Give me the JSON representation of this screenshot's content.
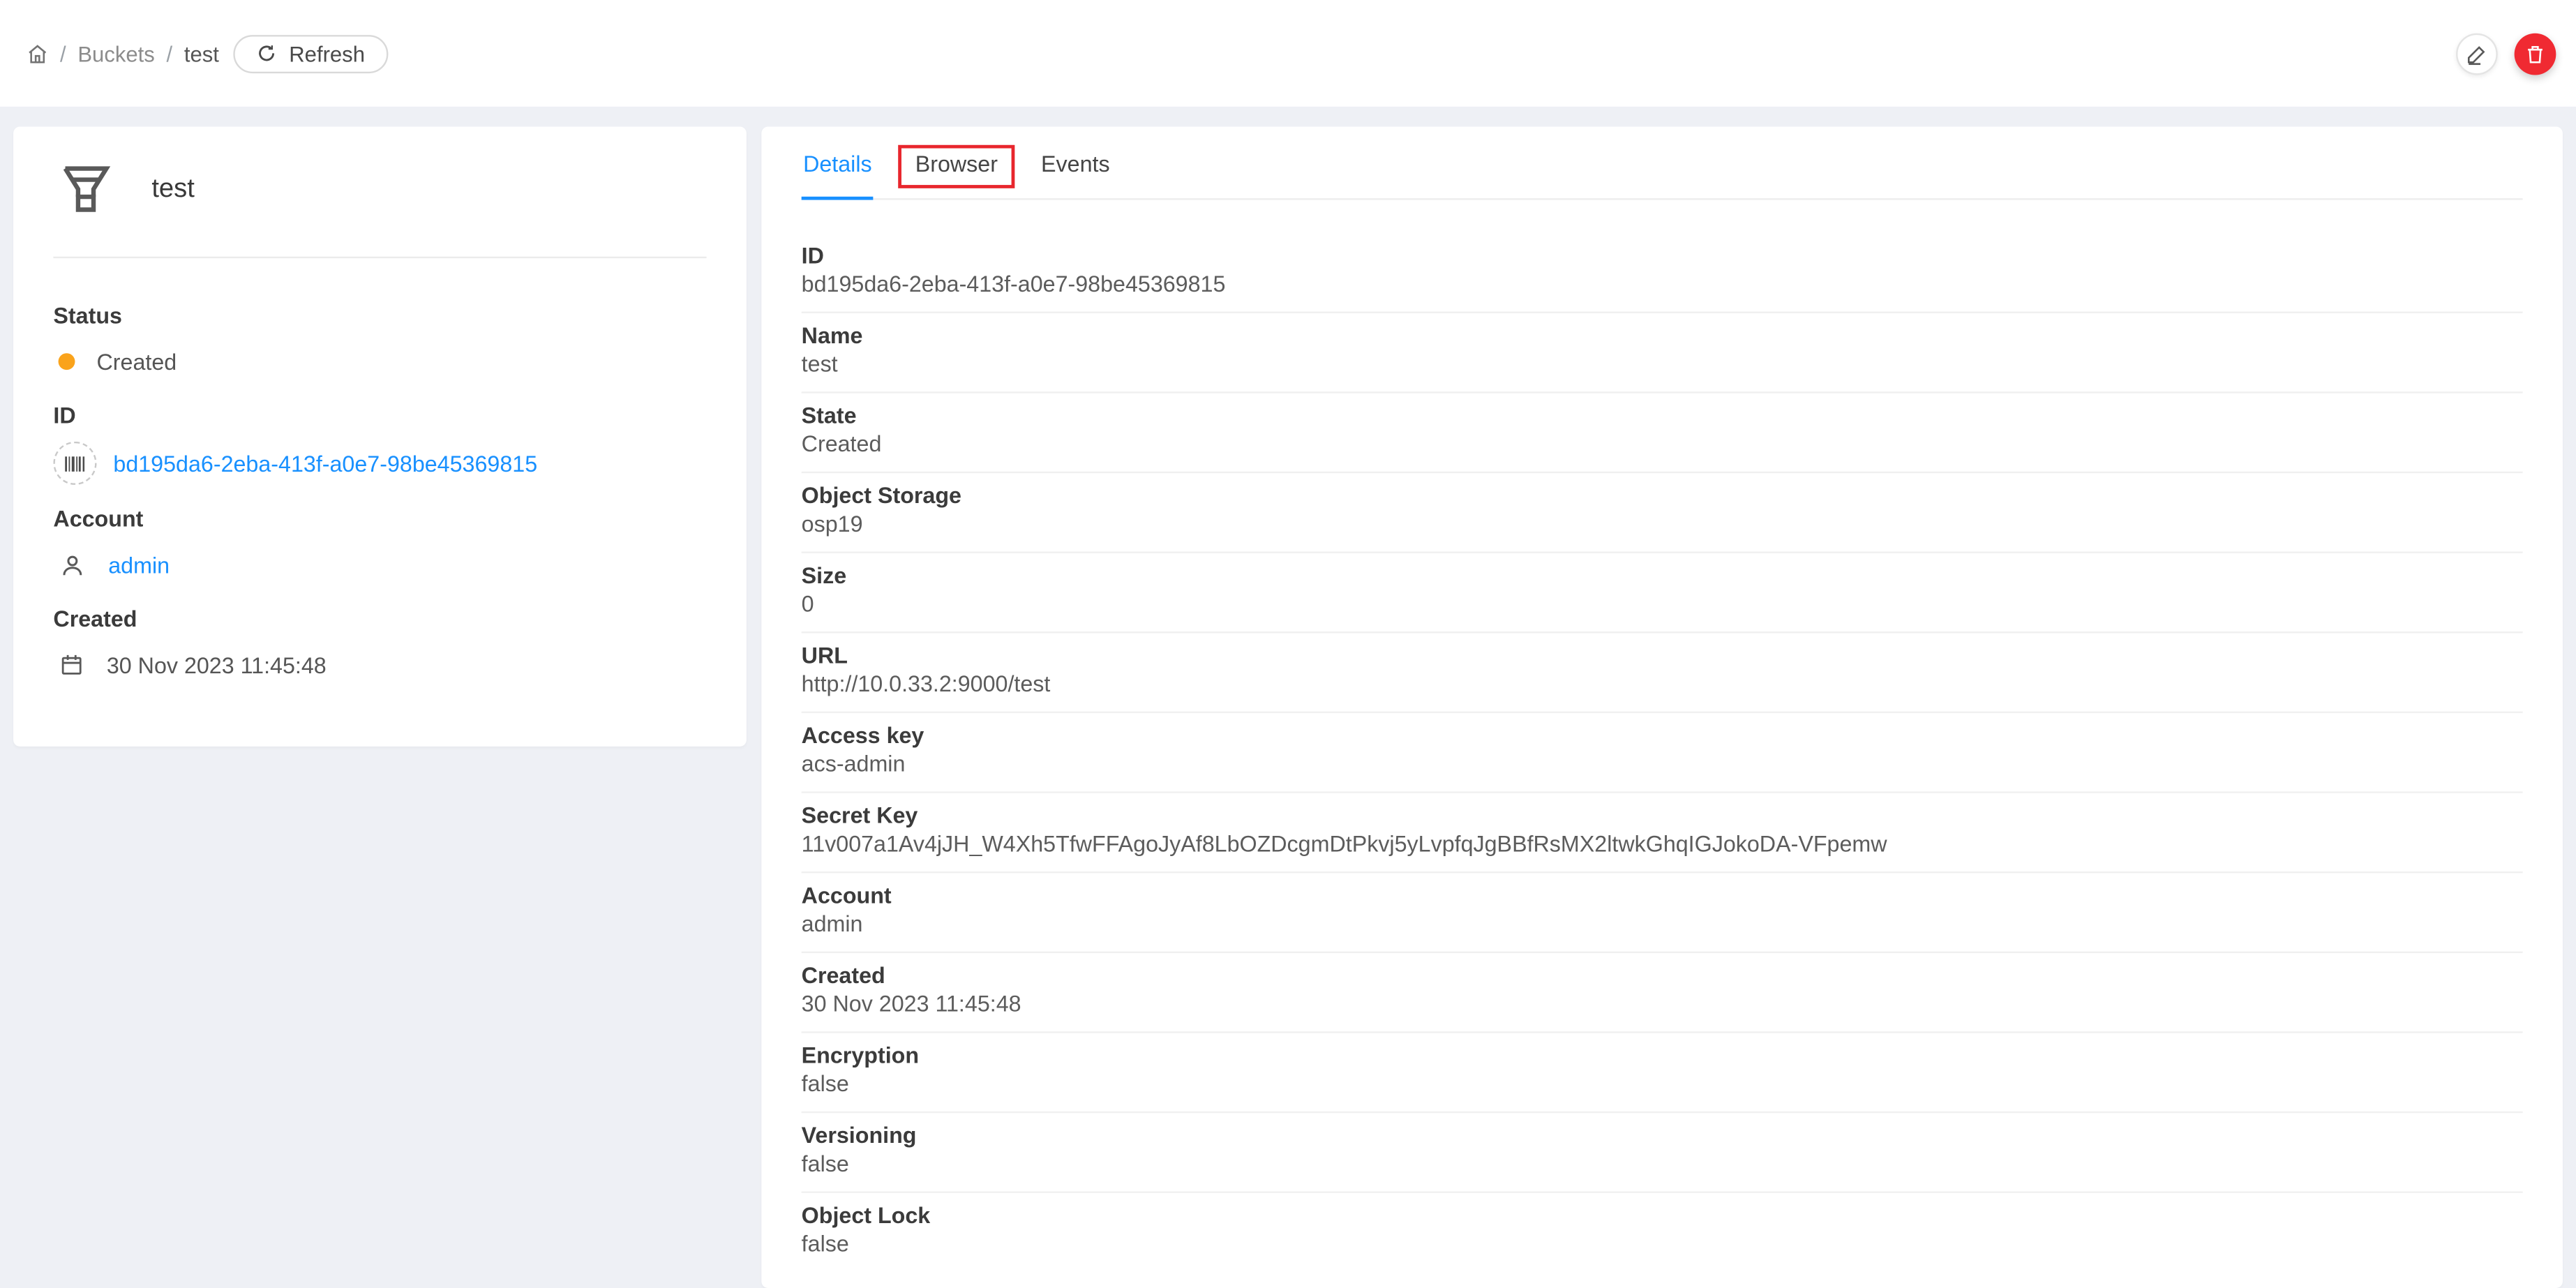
{
  "breadcrumb": {
    "separator": "/",
    "items": [
      "Buckets",
      "test"
    ],
    "refresh_label": "Refresh"
  },
  "header_actions": {
    "edit_icon": "pencil",
    "delete_icon": "trash"
  },
  "info_card": {
    "title": "test",
    "sections": [
      {
        "label": "Status",
        "value": "Created"
      },
      {
        "label": "ID",
        "value": "bd195da6-2eba-413f-a0e7-98be45369815"
      },
      {
        "label": "Account",
        "value": "admin"
      },
      {
        "label": "Created",
        "value": "30 Nov 2023 11:45:48"
      }
    ]
  },
  "tabs": [
    {
      "label": "Details",
      "active": true
    },
    {
      "label": "Browser",
      "annotated": true
    },
    {
      "label": "Events",
      "active": false
    }
  ],
  "details": {
    "rows": [
      {
        "label": "ID",
        "value": "bd195da6-2eba-413f-a0e7-98be45369815"
      },
      {
        "label": "Name",
        "value": "test"
      },
      {
        "label": "State",
        "value": "Created"
      },
      {
        "label": "Object Storage",
        "value": "osp19"
      },
      {
        "label": "Size",
        "value": "0"
      },
      {
        "label": "URL",
        "value": "http://10.0.33.2:9000/test"
      },
      {
        "label": "Access key",
        "value": "acs-admin"
      },
      {
        "label": "Secret Key",
        "value": "11v007a1Av4jJH_W4Xh5TfwFFAgoJyAf8LbOZDcgmDtPkvj5yLvpfqJgBBfRsMX2ltwkGhqIGJokoDA-VFpemw"
      },
      {
        "label": "Account",
        "value": "admin"
      },
      {
        "label": "Created",
        "value": "30 Nov 2023 11:45:48"
      },
      {
        "label": "Encryption",
        "value": "false"
      },
      {
        "label": "Versioning",
        "value": "false"
      },
      {
        "label": "Object Lock",
        "value": "false"
      }
    ]
  },
  "colors": {
    "accent": "#1890ff",
    "status_dot": "#faa31b",
    "danger": "#f02a32",
    "annotation": "#e8262d"
  }
}
